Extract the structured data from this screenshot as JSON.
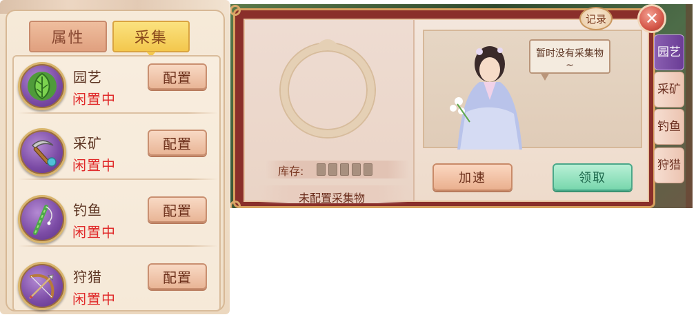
{
  "left": {
    "tabs": [
      {
        "label": "属性"
      },
      {
        "label": "采集"
      }
    ],
    "rows": [
      {
        "name": "园艺",
        "status": "闲置中",
        "button": "配置",
        "icon": "leaf-icon"
      },
      {
        "name": "采矿",
        "status": "闲置中",
        "button": "配置",
        "icon": "pickaxe-icon"
      },
      {
        "name": "钓鱼",
        "status": "闲置中",
        "button": "配置",
        "icon": "fishing-rod-icon"
      },
      {
        "name": "狩猎",
        "status": "闲置中",
        "button": "配置",
        "icon": "bow-icon"
      }
    ]
  },
  "right": {
    "record": "记录",
    "close": "✕",
    "stock_label": "库存:",
    "not_configured": "未配置采集物",
    "speech": "暂时没有采集物~",
    "speed_button": "加速",
    "claim_button": "领取",
    "side_tabs": [
      {
        "label": "园艺",
        "active": true
      },
      {
        "label": "采矿",
        "active": false
      },
      {
        "label": "钓鱼",
        "active": false
      },
      {
        "label": "狩猎",
        "active": false
      }
    ]
  },
  "colors": {
    "status_red": "#e02a2a",
    "accent_gold": "#f3c74d",
    "claim_green": "#78d7ad",
    "active_tab_purple": "#6a3c95"
  }
}
